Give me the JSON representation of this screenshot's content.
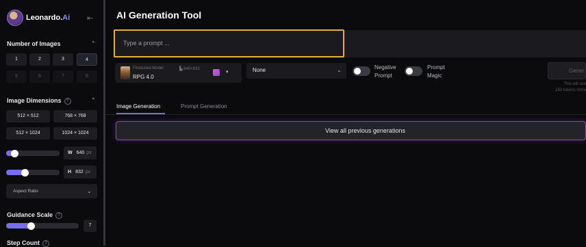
{
  "brand": {
    "name_part1": "Leonardo.",
    "name_part2": "Ai"
  },
  "sidebar": {
    "num_images": {
      "title": "Number of Images",
      "options": [
        "1",
        "2",
        "3",
        "4",
        "5",
        "6",
        "7",
        "8"
      ],
      "selected": "4"
    },
    "dimensions": {
      "title": "Image Dimensions",
      "presets": [
        "512 × 512",
        "768 × 768",
        "512 × 1024",
        "1024 × 1024"
      ],
      "width_label": "W",
      "width_value": "640",
      "width_unit": "px",
      "height_label": "H",
      "height_value": "832",
      "height_unit": "px",
      "width_slider_fraction": 0.1,
      "height_slider_fraction": 0.3,
      "aspect_ratio_label": "Aspect Ratio"
    },
    "guidance": {
      "title": "Guidance Scale",
      "value": "7",
      "slider_fraction": 0.3
    },
    "step_count": {
      "title": "Step Count"
    }
  },
  "main": {
    "title": "AI Generation Tool",
    "prompt_placeholder": "Type a prompt ...",
    "model": {
      "subtitle": "Finetuned Model",
      "dims": "640×832",
      "name": "RPG 4.0"
    },
    "style_select": "None",
    "negative_prompt_label": "Negative Prompt",
    "prompt_magic_label": "Prompt Magic",
    "generate_label": "Gener",
    "generate_note_line1": "This will use",
    "generate_note_line2": "250 tokens rema",
    "tabs": [
      {
        "label": "Image Generation",
        "active": true
      },
      {
        "label": "Prompt Generation",
        "active": false
      }
    ],
    "view_all_label": "View all previous generations"
  },
  "colors": {
    "accent": "#7a6cf0",
    "prompt_border": "#e3b23c",
    "glow": "#8a46c8"
  }
}
